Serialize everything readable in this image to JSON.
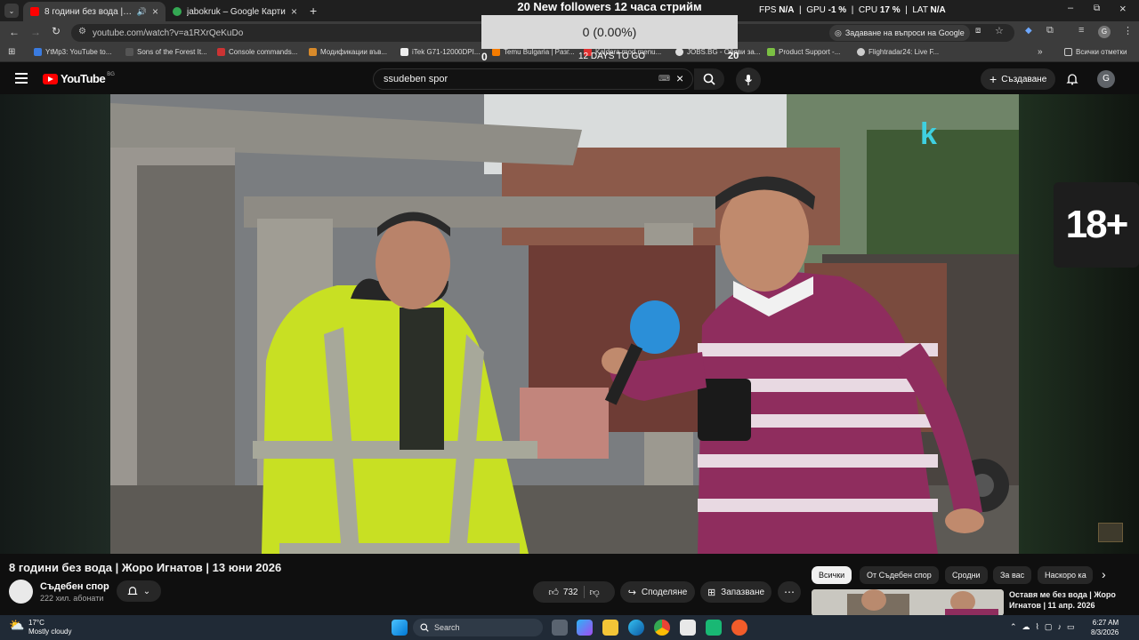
{
  "tabs": [
    {
      "label": "8 години без вода | Жоро",
      "active": true,
      "color": "#ff0000"
    },
    {
      "label": "jabokruk – Google Карти",
      "active": false,
      "color": "#34a853"
    }
  ],
  "address": {
    "url": "youtube.com/watch?v=a1RXrQeKuDo"
  },
  "bookmarks": [
    "YtMp3: YouTube to...",
    "Sons of the Forest It...",
    "Console commands...",
    "Модификации във...",
    "iTek G71-12000DPI...",
    "Temu Bulgaria | Pазг...",
    "Kaldera mod menu...",
    "JOBS.BG - Обяви за...",
    "Product Support -...",
    "Flightradar24: Live F...",
    "Всички отметки"
  ],
  "stream_overlay": {
    "title": "20 New followers 12 часа стрийм",
    "progress_text": "0 (0.00%)",
    "progress": 0,
    "start": "0",
    "goal": "20",
    "days": "12 DAYS TO GO"
  },
  "stats": {
    "fps_label": "FPS",
    "fps": "N/A",
    "gpu_label": "GPU",
    "gpu": "-1 %",
    "cpu_label": "CPU",
    "cpu": "17 %",
    "lat_label": "LAT",
    "lat": "N/A"
  },
  "chrome_right": {
    "ask_google": "Задаване на въпроси на Google",
    "avatar": "G"
  },
  "youtube": {
    "logo": "YouTube",
    "region": "BG",
    "search_query": "ssudeben spor",
    "create_label": "Създаване",
    "avatar": "G"
  },
  "video": {
    "badge": "18+",
    "channel_logo": "k"
  },
  "info": {
    "title": "8 години без вода | Жоро Игнатов | 13 юни 2026",
    "channel": "Съдебен спор",
    "subs": "222 хил. абонати",
    "likes": "732",
    "share": "Споделяне",
    "save": "Запазване"
  },
  "chips": [
    {
      "label": "Всички",
      "selected": true
    },
    {
      "label": "От Съдебен спор",
      "selected": false
    },
    {
      "label": "Сродни",
      "selected": false
    },
    {
      "label": "За вас",
      "selected": false
    },
    {
      "label": "Наскоро ка",
      "selected": false
    }
  ],
  "recommendation": {
    "title": "Оставя ме без вода | Жоро Игнатов | 11 апр. 2026"
  },
  "taskbar": {
    "weather_temp": "17°C",
    "weather_desc": "Mostly cloudy",
    "search": "Search",
    "time": "6:27 AM",
    "date": "8/3/2026"
  }
}
